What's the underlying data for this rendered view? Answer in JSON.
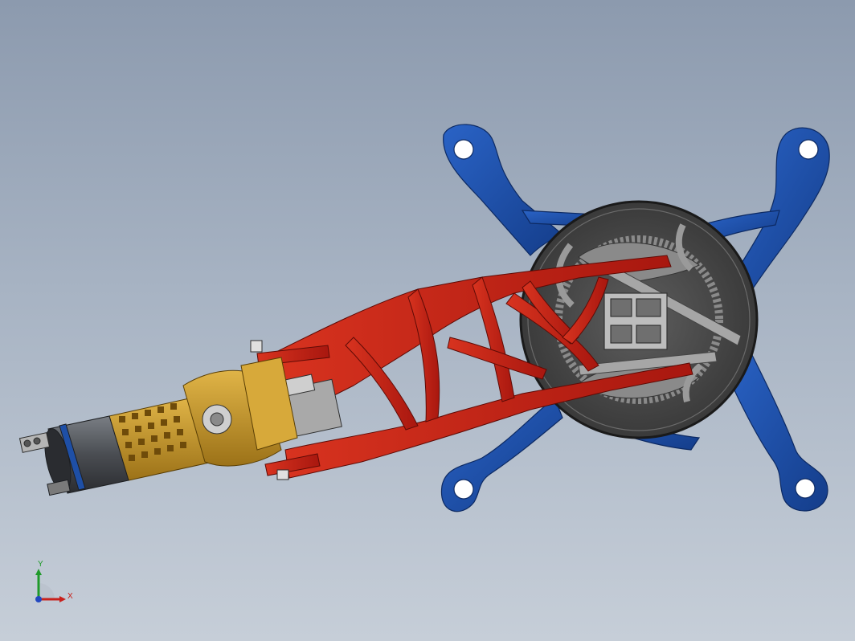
{
  "viewport": {
    "background_top": "#8c9aae",
    "background_bottom": "#c6ced8"
  },
  "model": {
    "parts": [
      {
        "name": "mounting-bracket",
        "color": "#1c4fa8"
      },
      {
        "name": "disc-wheel",
        "color": "#4a4a4a"
      },
      {
        "name": "lattice-arm",
        "color": "#c4261d"
      },
      {
        "name": "motor-housing",
        "color": "#c99a2e"
      },
      {
        "name": "servo-gearbox",
        "color": "#9c9c9c"
      },
      {
        "name": "motor-can",
        "color": "#5b5e63"
      },
      {
        "name": "connector-plug",
        "color": "#b5b5b5"
      }
    ]
  },
  "triad": {
    "x_label": "X",
    "y_label": "Y",
    "x_color": "#c8201c",
    "y_color": "#1f9a2a",
    "z_color": "#2248c0"
  }
}
